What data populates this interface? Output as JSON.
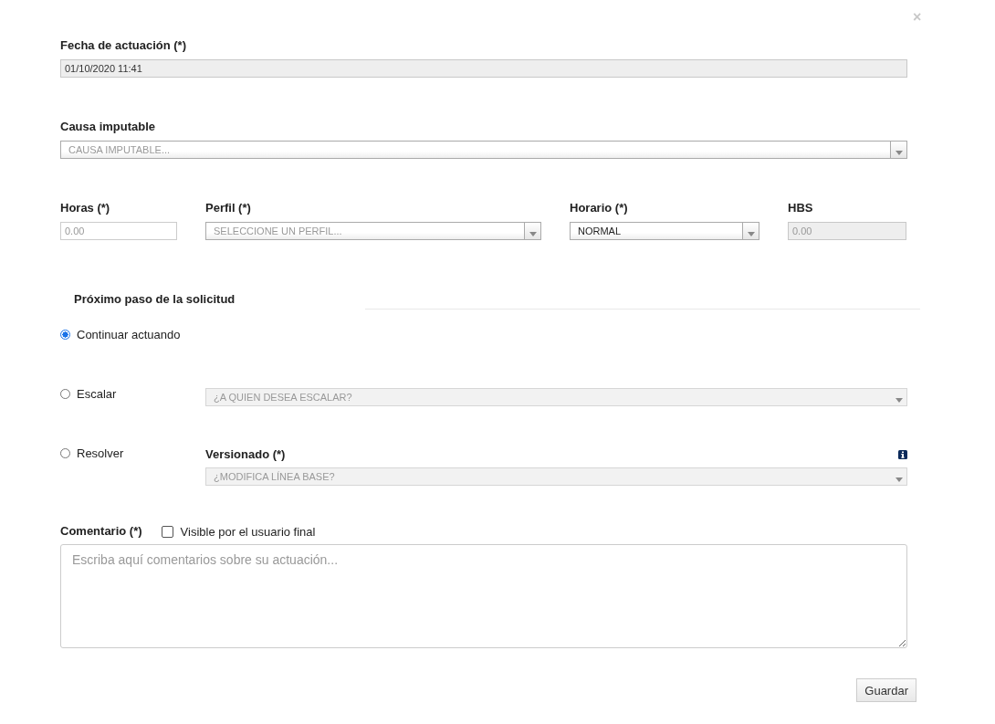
{
  "close": "×",
  "fecha": {
    "label": "Fecha de actuación (*)",
    "field": {
      "kind": "input",
      "value": "01/10/2020 11:41",
      "disabled": true
    }
  },
  "causa": {
    "label": "Causa imputable",
    "field": {
      "kind": "select",
      "placeholder": "CAUSA IMPUTABLE...",
      "disabled": false
    }
  },
  "row_fields": [
    {
      "label": "Horas (*)",
      "field": {
        "kind": "input",
        "placeholder": "0.00",
        "disabled": false
      }
    },
    {
      "label": "Perfil (*)",
      "field": {
        "kind": "select",
        "placeholder": "SELECCIONE UN PERFIL...",
        "disabled": false
      }
    },
    {
      "label": "Horario (*)",
      "field": {
        "kind": "select",
        "value": "NORMAL",
        "disabled": false
      }
    },
    {
      "label": "HBS",
      "field": {
        "kind": "input",
        "placeholder": "0.00",
        "disabled": true
      }
    }
  ],
  "section_title": "Próximo paso de la solicitud",
  "options": [
    {
      "label": "Continuar actuando",
      "selected": true
    },
    {
      "label": "Escalar",
      "selected": false,
      "field": {
        "kind": "select",
        "placeholder": "¿A QUIEN DESEA ESCALAR?",
        "disabled": true
      }
    },
    {
      "label": "Resolver",
      "selected": false,
      "field_label": "Versionado (*)",
      "info": true,
      "field": {
        "kind": "select",
        "placeholder": "¿MODIFICA LÍNEA BASE?",
        "disabled": true
      }
    }
  ],
  "comment": {
    "label": "Comentario (*)",
    "checkbox": {
      "label": "Visible por el usuario final",
      "checked": false
    },
    "placeholder": "Escriba aquí comentarios sobre su actuación..."
  },
  "save_button": "Guardar"
}
